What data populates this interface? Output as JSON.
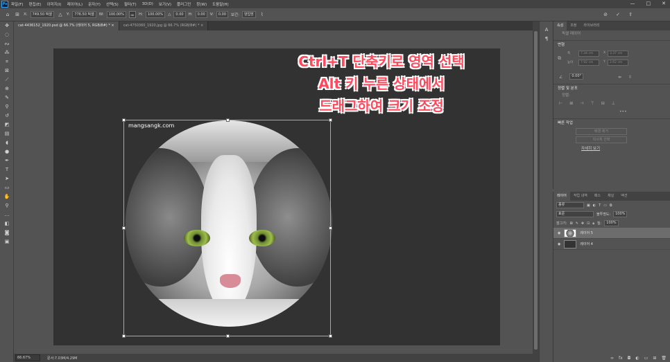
{
  "menubar": {
    "items": [
      "파일(F)",
      "편집(E)",
      "이미지(I)",
      "레이어(L)",
      "문자(Y)",
      "선택(S)",
      "필터(T)",
      "3D(D)",
      "보기(V)",
      "플러그인",
      "창(W)",
      "도움말(H)"
    ],
    "minimize": "—",
    "maximize": "□",
    "close": "✕"
  },
  "options": {
    "x_label": "X:",
    "x_value": "749.50 픽셀",
    "y_label": "Y:",
    "y_value": "776.50 픽셀",
    "w_label": "W:",
    "w_value": "100.00%",
    "h_label": "H:",
    "h_value": "100.00%",
    "angle_label": "△",
    "angle_value": "0.00",
    "hskew_label": "H:",
    "hskew_value": "0.00",
    "vskew_label": "V:",
    "vskew_value": "0.00",
    "interp_label": "보간:",
    "interp_value": "양입방",
    "cancel": "⊘",
    "commit": "✓",
    "share": "⇪"
  },
  "tabs": [
    {
      "label": "cat-4436152_1920.psd @ 66.7% (레이어 5, RGB/8#) *  ×"
    },
    {
      "label": "cat-4750360_1920.jpg @ 66.7% (RGB/8#) *  ×"
    }
  ],
  "canvas": {
    "watermark": "mangsangk.com",
    "annotation_line1": "Ctrl+T 단축키로 영역 선택",
    "annotation_line2": "Alt 키 누른 상태에서",
    "annotation_line3": "드래그하여 크기 조정"
  },
  "status": {
    "zoom": "66.67%",
    "doc": "문서:7.03M/4.29M"
  },
  "properties": {
    "tabs": [
      "속성",
      "조정",
      "라이브러리"
    ],
    "layer_kind": "픽셀 레이어",
    "transform_title": "변형",
    "w": "7.34 cm",
    "x": "3.37 cm",
    "h": "7.92 cm",
    "y": "2.62 cm",
    "w_lbl": "폭",
    "x_lbl": "X",
    "h_lbl": "높이",
    "y_lbl": "Y",
    "angle": "0.00°",
    "align_title": "정렬 및 분포",
    "align_sub": "정렬:",
    "quick_title": "빠른 작업",
    "remove_bg": "배경 제거",
    "select_subject": "피사체 선택",
    "more_link": "자세히 보기"
  },
  "layers": {
    "tabs": [
      "레이어",
      "작업 내역",
      "패스",
      "채널",
      "액션"
    ],
    "kind": "종류",
    "blend": "표준",
    "opacity_label": "불투명도:",
    "opacity": "100%",
    "lock_label": "잠그기:",
    "fill_label": "칠:",
    "fill": "100%",
    "items": [
      {
        "name": "레이어 5"
      },
      {
        "name": "레이어 4"
      }
    ]
  }
}
